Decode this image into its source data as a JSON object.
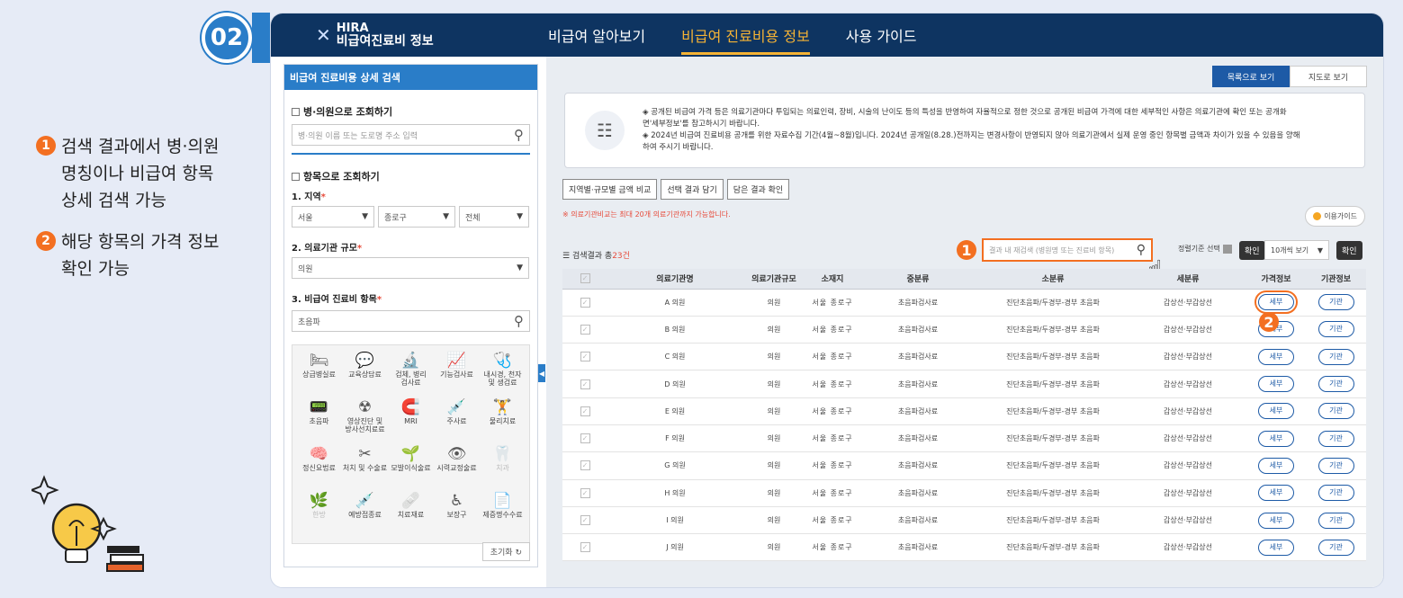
{
  "step": "02",
  "notes": [
    {
      "num": "1",
      "text": "검색 결과에서 병·의원\n명칭이나 비급여 항목\n상세 검색 가능"
    },
    {
      "num": "2",
      "text": "해당 항목의 가격 정보\n확인 가능"
    }
  ],
  "header": {
    "logo_top": "HIRA",
    "logo_bottom": "비급여진료비 정보",
    "nav": [
      "비급여 알아보기",
      "비급여 진료비용 정보",
      "사용 가이드"
    ],
    "active_nav": 1
  },
  "sidebar": {
    "title": "비급여 진료비용 상세 검색",
    "hospital_section": "병·의원으로 조회하기",
    "hospital_placeholder": "병·의원 이름 또는 도로명 주소 입력",
    "item_section": "항목으로 조회하기",
    "region_label": "1. 지역",
    "region_values": [
      "서울",
      "종로구",
      "전체"
    ],
    "scale_label": "2. 의료기관 규모",
    "scale_value": "의원",
    "item_label": "3. 비급여 진료비 항목",
    "item_value": "초음파",
    "categories": [
      {
        "name": "상급병실료",
        "icon": "bed-icon",
        "glyph": "🛏"
      },
      {
        "name": "교육상담료",
        "icon": "consult-icon",
        "glyph": "💬"
      },
      {
        "name": "검체, 병리\n검사료",
        "icon": "microscope-icon",
        "glyph": "🔬"
      },
      {
        "name": "기능검사료",
        "icon": "function-test-icon",
        "glyph": "📈"
      },
      {
        "name": "내시경, 천자\n및 생검료",
        "icon": "endoscope-icon",
        "glyph": "🩺"
      },
      {
        "name": "초음파",
        "icon": "ultrasound-icon",
        "glyph": "📟"
      },
      {
        "name": "영상진단 및\n방사선치료료",
        "icon": "radiology-icon",
        "glyph": "☢"
      },
      {
        "name": "MRI",
        "icon": "mri-icon",
        "glyph": "🧲"
      },
      {
        "name": "주사료",
        "icon": "syringe-icon",
        "glyph": "💉"
      },
      {
        "name": "물리치료",
        "icon": "physio-icon",
        "glyph": "🏋"
      },
      {
        "name": "정신요법료",
        "icon": "mind-icon",
        "glyph": "🧠"
      },
      {
        "name": "처치 및 수술료",
        "icon": "surgery-icon",
        "glyph": "✂"
      },
      {
        "name": "모발이식술료",
        "icon": "hair-icon",
        "glyph": "🌱"
      },
      {
        "name": "시력교정술료",
        "icon": "eye-icon",
        "glyph": "👁"
      },
      {
        "name": "치과",
        "icon": "tooth-icon",
        "glyph": "🦷",
        "dim": true
      },
      {
        "name": "한방",
        "icon": "oriental-icon",
        "glyph": "🌿",
        "dim": true
      },
      {
        "name": "예방접종료",
        "icon": "vaccine-icon",
        "glyph": "💉"
      },
      {
        "name": "치료재료",
        "icon": "material-icon",
        "glyph": "🩹"
      },
      {
        "name": "보장구",
        "icon": "wheelchair-icon",
        "glyph": "♿"
      },
      {
        "name": "제증명수수료",
        "icon": "certificate-icon",
        "glyph": "📄"
      }
    ],
    "reset": "초기화"
  },
  "main": {
    "view_tabs": [
      "목록으로 보기",
      "지도로 보기"
    ],
    "notice": "◈ 공개된 비급여 가격 등은 의료기관마다 투입되는 의료인력, 장비, 시술의 난이도 등의 특성을 반영하여 자율적으로 정한 것으로 공개된 비급여 가격에 대한 세부적인 사항은 의료기관에 확인 또는 공개화\n면'세부정보'를 참고하시기 바랍니다.\n◈ 2024년 비급여 진료비용 공개를 위한 자료수집 기간(4월~8월)입니다. 2024년 공개일(8.28.)전까지는 변경사항이 반영되지 않아 의료기관에서 실제 운영 중인 항목별 금액과 차이가 있을 수 있음을 양해\n하여 주시기 바랍니다.",
    "buttons": [
      "지역별·규모별 금액 비교",
      "선택 결과 담기",
      "담은 결과 확인"
    ],
    "warning": "※ 의료기관비교는 최대 20개 의료기관까지 가능합니다.",
    "guide": "이용가이드",
    "count_prefix": "검색결과 총",
    "count_num": "23건",
    "search_placeholder": "결과 내 재검색 (병원명 또는 진료비 항목)",
    "filter_label": "정렬기준 선택",
    "confirm": "확인",
    "page_size": "10개씩 보기",
    "columns": [
      "의료기관명",
      "의료기관규모",
      "소재지",
      "중분류",
      "소분류",
      "세분류",
      "가격정보",
      "기관정보"
    ],
    "rows": [
      {
        "name": "A 의원",
        "scale": "의원",
        "loc": "서울 종로구",
        "mid": "초음파검사료",
        "small": "진단초음파/두경부-경부 초음파",
        "detail": "갑상선·부갑상선",
        "price": "세부",
        "org": "기관"
      },
      {
        "name": "B 의원",
        "scale": "의원",
        "loc": "서울 종로구",
        "mid": "초음파검사료",
        "small": "진단초음파/두경부-경부 초음파",
        "detail": "갑상선·부갑상선",
        "price": "세부",
        "org": "기관"
      },
      {
        "name": "C 의원",
        "scale": "의원",
        "loc": "서울 종로구",
        "mid": "초음파검사료",
        "small": "진단초음파/두경부-경부 초음파",
        "detail": "갑상선·부갑상선",
        "price": "세부",
        "org": "기관"
      },
      {
        "name": "D 의원",
        "scale": "의원",
        "loc": "서울 종로구",
        "mid": "초음파검사료",
        "small": "진단초음파/두경부-경부 초음파",
        "detail": "갑상선·부갑상선",
        "price": "세부",
        "org": "기관"
      },
      {
        "name": "E 의원",
        "scale": "의원",
        "loc": "서울 종로구",
        "mid": "초음파검사료",
        "small": "진단초음파/두경부-경부 초음파",
        "detail": "갑상선·부갑상선",
        "price": "세부",
        "org": "기관"
      },
      {
        "name": "F 의원",
        "scale": "의원",
        "loc": "서울 종로구",
        "mid": "초음파검사료",
        "small": "진단초음파/두경부-경부 초음파",
        "detail": "갑상선·부갑상선",
        "price": "세부",
        "org": "기관"
      },
      {
        "name": "G 의원",
        "scale": "의원",
        "loc": "서울 종로구",
        "mid": "초음파검사료",
        "small": "진단초음파/두경부-경부 초음파",
        "detail": "갑상선·부갑상선",
        "price": "세부",
        "org": "기관"
      },
      {
        "name": "H 의원",
        "scale": "의원",
        "loc": "서울 종로구",
        "mid": "초음파검사료",
        "small": "진단초음파/두경부-경부 초음파",
        "detail": "갑상선·부갑상선",
        "price": "세부",
        "org": "기관"
      },
      {
        "name": "I 의원",
        "scale": "의원",
        "loc": "서울 종로구",
        "mid": "초음파검사료",
        "small": "진단초음파/두경부-경부 초음파",
        "detail": "갑상선·부갑상선",
        "price": "세부",
        "org": "기관"
      },
      {
        "name": "J 의원",
        "scale": "의원",
        "loc": "서울 종로구",
        "mid": "초음파검사료",
        "small": "진단초음파/두경부-경부 초음파",
        "detail": "갑상선·부갑상선",
        "price": "세부",
        "org": "기관"
      }
    ]
  },
  "colors": {
    "accent": "#2a7dc8",
    "nav": "#0e3461",
    "highlight": "#f36f21",
    "active_nav": "#f5b335"
  }
}
